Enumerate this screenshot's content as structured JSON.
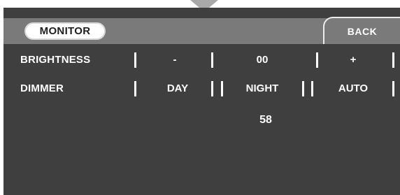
{
  "header": {
    "tab_label": "MONITOR",
    "back_label": "BACK"
  },
  "brightness": {
    "label": "BRIGHTNESS",
    "minus_label": "-",
    "value": "00",
    "plus_label": "+"
  },
  "dimmer": {
    "label": "DIMMER",
    "options": [
      "DAY",
      "NIGHT",
      "AUTO"
    ]
  },
  "readout": {
    "value": "58"
  },
  "colors": {
    "screen_bg": "#3f3f3f",
    "header_bg": "#7a7a7a",
    "text": "#ffffff",
    "tab_bg": "#ffffff"
  },
  "icons": {
    "top_indicator": "down-arrow-icon"
  }
}
